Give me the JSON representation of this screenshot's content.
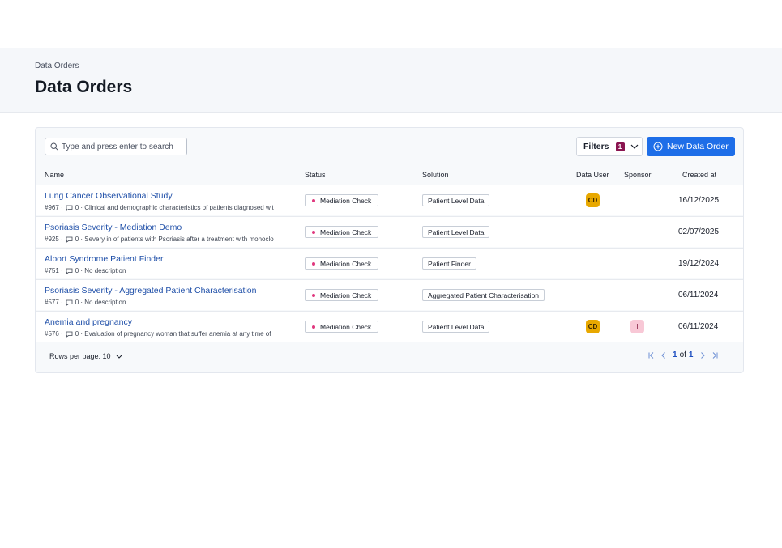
{
  "header": {
    "breadcrumb": "Data Orders",
    "title": "Data Orders"
  },
  "toolbar": {
    "search_placeholder": "Type and press enter to search",
    "filters_label": "Filters",
    "filters_count": "1",
    "new_label": "New Data Order"
  },
  "columns": {
    "name": "Name",
    "status": "Status",
    "solution": "Solution",
    "data_user": "Data User",
    "sponsor": "Sponsor",
    "created": "Created at"
  },
  "rows": [
    {
      "name": "Lung Cancer Observational Study",
      "id": "#967 ·",
      "comments": "0",
      "desc": "· Clinical and demographic characteristics of patients diagnosed wit",
      "status": "Mediation Check",
      "solution": "Patient Level Data",
      "data_user": "CD",
      "sponsor": "",
      "created": "16/12/2025"
    },
    {
      "name": "Psoriasis Severity - Mediation Demo",
      "id": "#925 ·",
      "comments": "0",
      "desc": "· Severy in of patients with Psoriasis after a treatment with monoclo",
      "status": "Mediation Check",
      "solution": "Patient Level Data",
      "data_user": "",
      "sponsor": "",
      "created": "02/07/2025"
    },
    {
      "name": "Alport Syndrome Patient Finder",
      "id": "#751 ·",
      "comments": "0",
      "desc": "· No description",
      "status": "Mediation Check",
      "solution": "Patient Finder",
      "data_user": "",
      "sponsor": "",
      "created": "19/12/2024"
    },
    {
      "name": "Psoriasis Severity - Aggregated Patient Characterisation",
      "id": "#577 ·",
      "comments": "0",
      "desc": "· No description",
      "status": "Mediation Check",
      "solution": "Aggregated Patient Characterisation",
      "data_user": "",
      "sponsor": "",
      "created": "06/11/2024"
    },
    {
      "name": "Anemia and pregnancy",
      "id": "#576 ·",
      "comments": "0",
      "desc": "· Evaluation of pregnancy woman that suffer anemia at any time of",
      "status": "Mediation Check",
      "solution": "Patient Level Data",
      "data_user": "CD",
      "sponsor": "I",
      "created": "06/11/2024"
    }
  ],
  "footer": {
    "rows_per_page": "Rows per page: 10",
    "page_current": "1",
    "page_of": "of",
    "page_total": "1"
  },
  "colors": {
    "accent": "#1e6ee8",
    "link": "#1f4fa8",
    "status_dot": "#e0387e",
    "filter_badge": "#8a1450",
    "avatar_user": "#e8a800",
    "avatar_sponsor": "#f8c8d6"
  },
  "icons": {
    "search": "search-icon",
    "chevron": "chevron-down-icon",
    "add": "plus-circle-icon",
    "comment": "comment-icon"
  }
}
